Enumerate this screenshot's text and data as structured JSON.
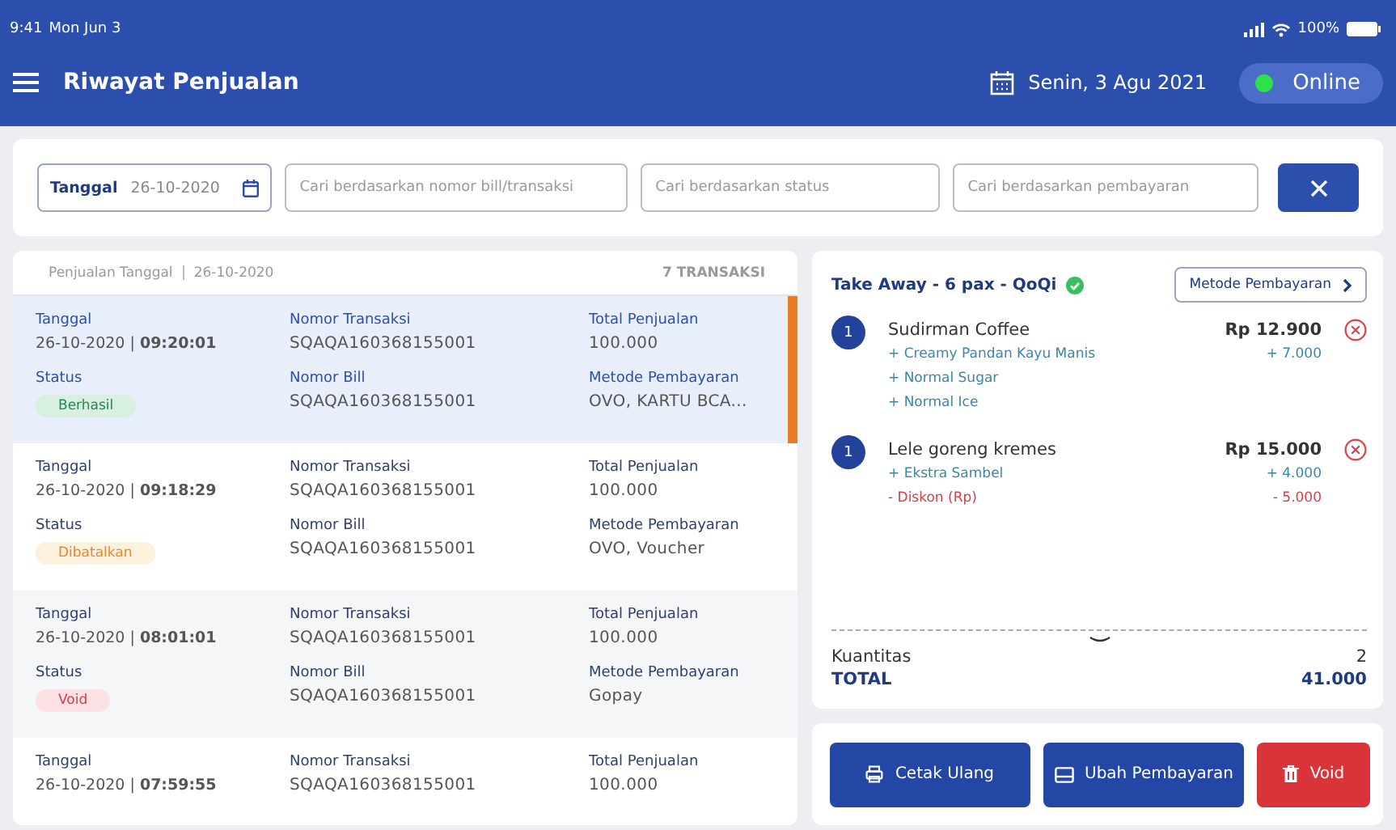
{
  "status_bar": {
    "time": "9:41",
    "date": "Mon Jun 3",
    "battery": "100%"
  },
  "header": {
    "title": "Riwayat Penjualan",
    "date": "Senin, 3 Agu 2021",
    "connection": {
      "label": "Online",
      "on": true
    }
  },
  "filters": {
    "date_label": "Tanggal",
    "date_value": "26-10-2020",
    "search_bill": {
      "placeholder": "Cari berdasarkan nomor bill/transaksi"
    },
    "search_status": {
      "placeholder": "Cari berdasarkan status"
    },
    "search_payment": {
      "placeholder": "Cari berdasarkan pembayaran"
    }
  },
  "list": {
    "label": "Penjualan Tanggal",
    "date": "26-10-2020",
    "count": "7 TRANSAKSI",
    "rows": [
      {
        "selected": true,
        "date_label": "Tanggal",
        "date": "26-10-2020 | ",
        "time": "09:20:01",
        "trx_label": "Nomor Transaksi",
        "trx": "SQAQA160368155001",
        "total_label": "Total Penjualan",
        "total": "100.000",
        "status_label": "Status",
        "status": {
          "text": "Berhasil",
          "kind": "success"
        },
        "bill_label": "Nomor Bill",
        "bill": "SQAQA160368155001",
        "payment_label": "Metode Pembayaran",
        "payment": "OVO, KARTU BCA..."
      },
      {
        "selected": false,
        "date_label": "Tanggal",
        "date": "26-10-2020 | ",
        "time": "09:18:29",
        "trx_label": "Nomor Transaksi",
        "trx": "SQAQA160368155001",
        "total_label": "Total Penjualan",
        "total": "100.000",
        "status_label": "Status",
        "status": {
          "text": "Dibatalkan",
          "kind": "cancelled"
        },
        "bill_label": "Nomor Bill",
        "bill": "SQAQA160368155001",
        "payment_label": "Metode Pembayaran",
        "payment": "OVO, Voucher"
      },
      {
        "selected": false,
        "date_label": "Tanggal",
        "date": "26-10-2020 | ",
        "time": "08:01:01",
        "trx_label": "Nomor Transaksi",
        "trx": "SQAQA160368155001",
        "total_label": "Total Penjualan",
        "total": "100.000",
        "status_label": "Status",
        "status": {
          "text": "Void",
          "kind": "void"
        },
        "bill_label": "Nomor Bill",
        "bill": "SQAQA160368155001",
        "payment_label": "Metode Pembayaran",
        "payment": "Gopay"
      },
      {
        "selected": false,
        "date_label": "Tanggal",
        "date": "26-10-2020 | ",
        "time": "07:59:55",
        "trx_label": "Nomor Transaksi",
        "trx": "SQAQA160368155001",
        "total_label": "Total Penjualan",
        "total": "100.000"
      }
    ]
  },
  "detail": {
    "title": "Take Away - 6 pax - QoQi",
    "verified": true,
    "payment_button": "Metode Pembayaran",
    "items": [
      {
        "qty": "1",
        "name": "Sudirman Coffee",
        "price": "Rp 12.900",
        "modifiers": [
          {
            "kind": "addon",
            "text": "+ Creamy Pandan Kayu Manis",
            "price": "+ 7.000"
          },
          {
            "kind": "addon",
            "text": "+ Normal Sugar"
          },
          {
            "kind": "addon",
            "text": "+ Normal Ice"
          }
        ]
      },
      {
        "qty": "1",
        "name": "Lele goreng kremes",
        "price": "Rp 15.000",
        "modifiers": [
          {
            "kind": "addon",
            "text": "+ Ekstra Sambel",
            "price": "+ 4.000"
          },
          {
            "kind": "discount",
            "text": "- Diskon (Rp)",
            "price": "- 5.000"
          }
        ]
      }
    ],
    "quantity_label": "Kuantitas",
    "quantity": "2",
    "total_label": "TOTAL",
    "total": "41.000"
  },
  "actions": [
    {
      "kind": "print",
      "label": "Cetak Ulang"
    },
    {
      "kind": "payment",
      "label": "Ubah Pembayaran"
    },
    {
      "kind": "void",
      "label": "Void"
    }
  ]
}
